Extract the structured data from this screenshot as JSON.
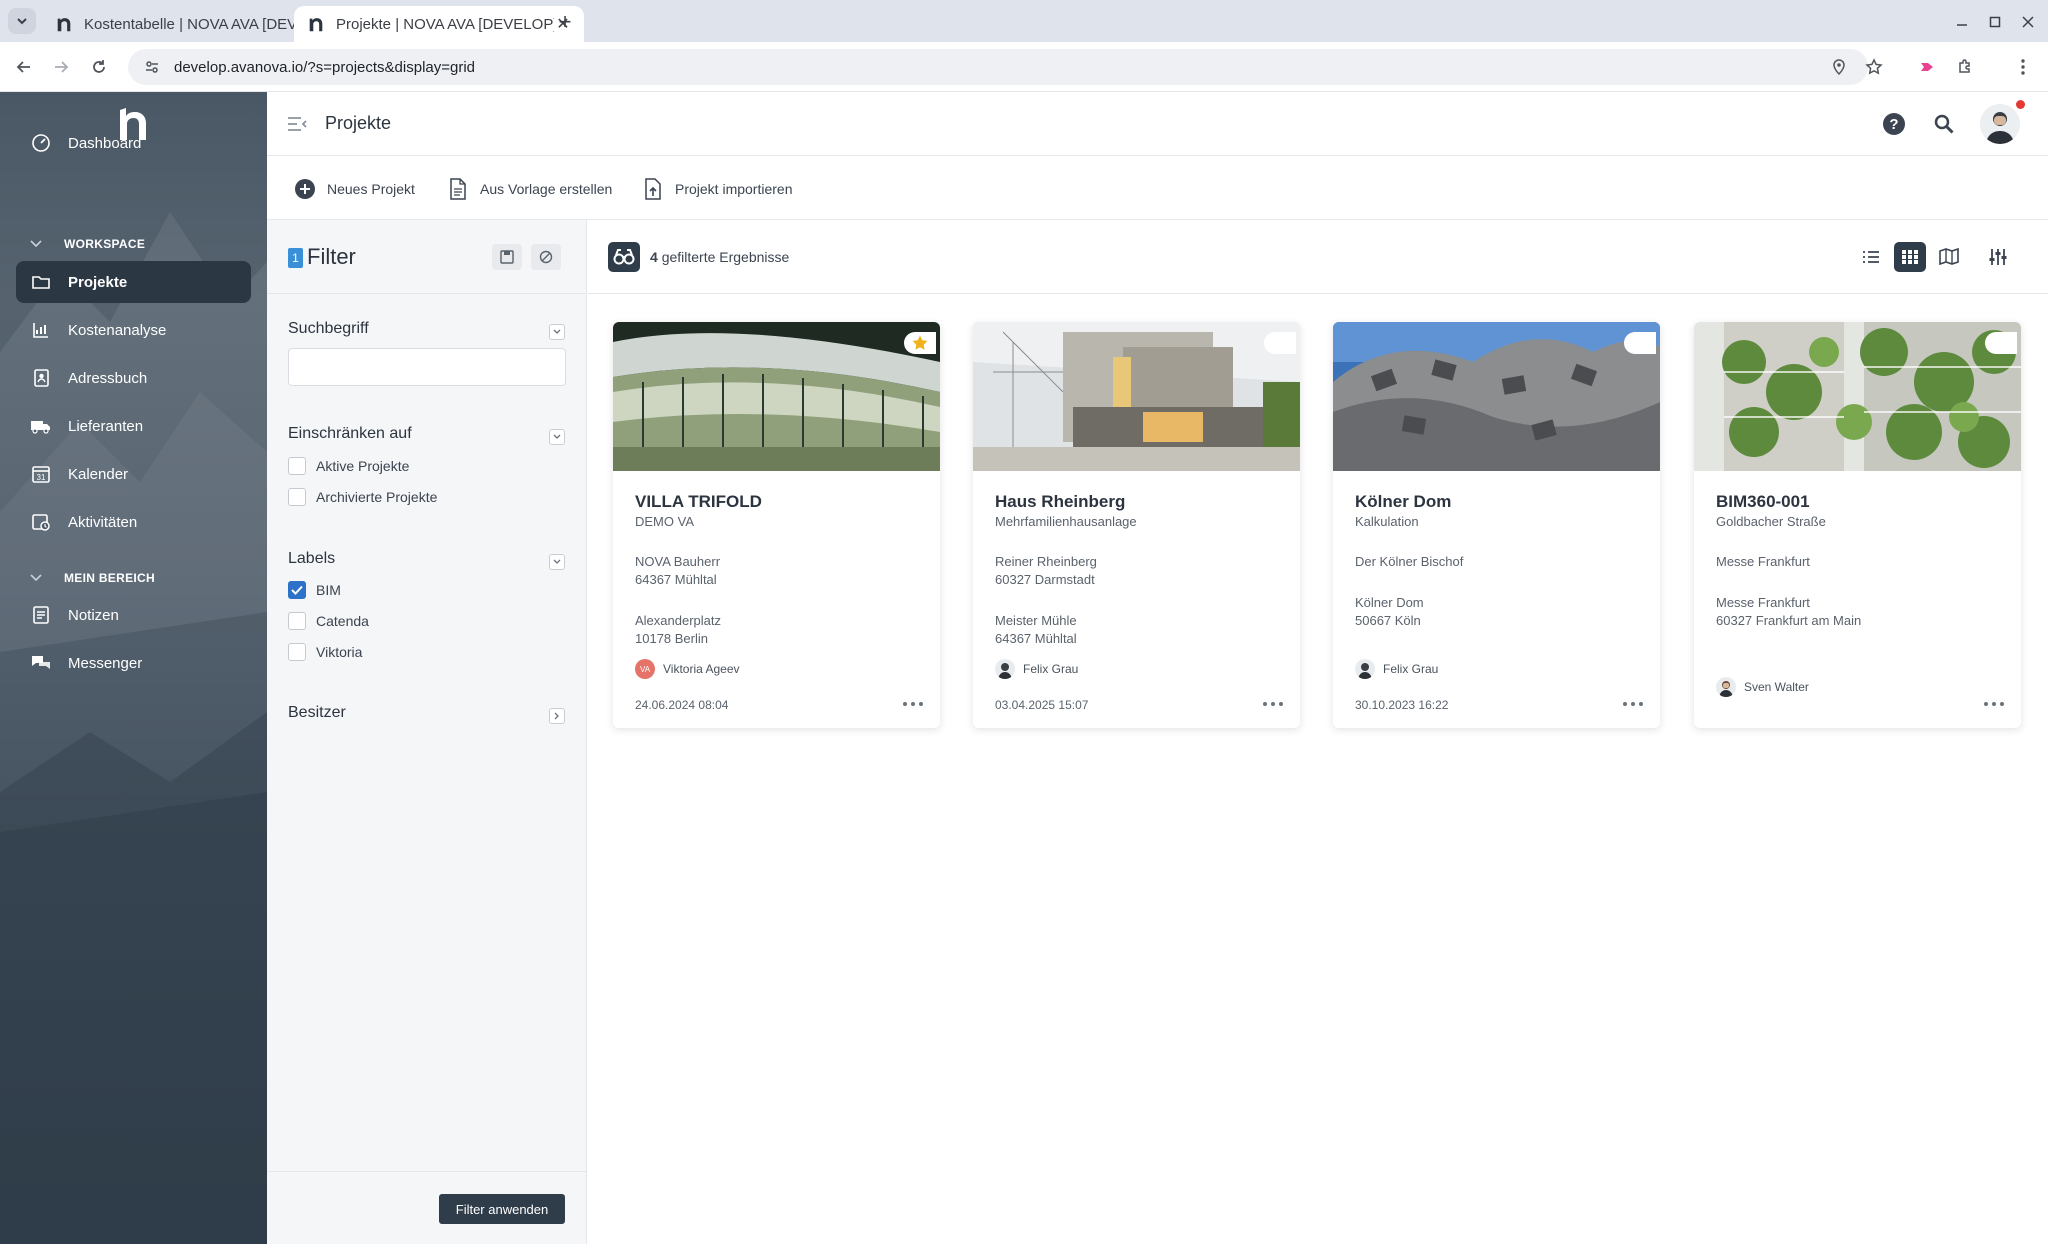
{
  "browser": {
    "tabs": [
      {
        "title": "Kostentabelle | NOVA AVA [DEVELOP]",
        "active": false
      },
      {
        "title": "Projekte | NOVA AVA [DEVELOP]",
        "active": true
      }
    ],
    "url": "develop.avanova.io/?s=projects&display=grid"
  },
  "sidebar": {
    "items_top": [
      {
        "label": "Dashboard",
        "icon": "speedometer-icon"
      }
    ],
    "section_workspace": "WORKSPACE",
    "items_workspace": [
      {
        "label": "Projekte",
        "icon": "folder-icon",
        "active": true
      },
      {
        "label": "Kostenanalyse",
        "icon": "chart-icon"
      },
      {
        "label": "Adressbuch",
        "icon": "address-book-icon"
      },
      {
        "label": "Lieferanten",
        "icon": "truck-icon"
      },
      {
        "label": "Kalender",
        "icon": "calendar-icon"
      },
      {
        "label": "Aktivitäten",
        "icon": "activity-icon"
      }
    ],
    "section_mine": "MEIN BEREICH",
    "items_mine": [
      {
        "label": "Notizen",
        "icon": "notes-icon"
      },
      {
        "label": "Messenger",
        "icon": "chat-icon"
      }
    ],
    "calendar_day": "31"
  },
  "header": {
    "title": "Projekte"
  },
  "toolbar": {
    "new_project": "Neues Projekt",
    "from_template": "Aus Vorlage erstellen",
    "import_project": "Projekt importieren"
  },
  "filter": {
    "badge": "1",
    "title": "Filter",
    "search_label": "Suchbegriff",
    "search_value": "",
    "restrict_label": "Einschränken auf",
    "restrict_options": [
      {
        "label": "Aktive Projekte",
        "checked": false
      },
      {
        "label": "Archivierte Projekte",
        "checked": false
      }
    ],
    "labels_label": "Labels",
    "label_options": [
      {
        "label": "BIM",
        "checked": true
      },
      {
        "label": "Catenda",
        "checked": false
      },
      {
        "label": "Viktoria",
        "checked": false
      }
    ],
    "owner_label": "Besitzer",
    "apply": "Filter anwenden"
  },
  "results": {
    "count": "4",
    "count_label": "gefilterte Ergebnisse"
  },
  "projects": [
    {
      "title": "VILLA TRIFOLD",
      "subtitle": "DEMO VA",
      "lines": [
        "NOVA Bauherr",
        "64367 Mühltal",
        "",
        "Alexanderplatz",
        "10178 Berlin"
      ],
      "owner": "Viktoria Ageev",
      "owner_initials": "VA",
      "date": "24.06.2024 08:04",
      "favorite": true
    },
    {
      "title": "Haus Rheinberg",
      "subtitle": "Mehrfamilienhausanlage",
      "lines": [
        "Reiner Rheinberg",
        "60327 Darmstadt",
        "",
        "Meister Mühle",
        "64367 Mühltal"
      ],
      "owner": "Felix Grau",
      "owner_initials": "",
      "date": "03.04.2025 15:07",
      "favorite": false
    },
    {
      "title": "Kölner Dom",
      "subtitle": "Kalkulation",
      "lines": [
        "Der Kölner Bischof",
        "",
        "Kölner Dom",
        "50667 Köln"
      ],
      "owner": "Felix Grau",
      "owner_initials": "",
      "date": "30.10.2023 16:22",
      "favorite": false
    },
    {
      "title": "BIM360-001",
      "subtitle": "Goldbacher Straße",
      "lines": [
        "Messe Frankfurt",
        "",
        "Messe Frankfurt",
        "60327 Frankfurt am Main"
      ],
      "owner": "Sven Walter",
      "owner_initials": "",
      "date": "",
      "favorite": false
    }
  ],
  "colors": {
    "sidebar_active": "#2b3743",
    "accent_blue": "#2b72c8",
    "dark_button": "#2f3c4a",
    "favorite_star": "#f2b21b"
  }
}
